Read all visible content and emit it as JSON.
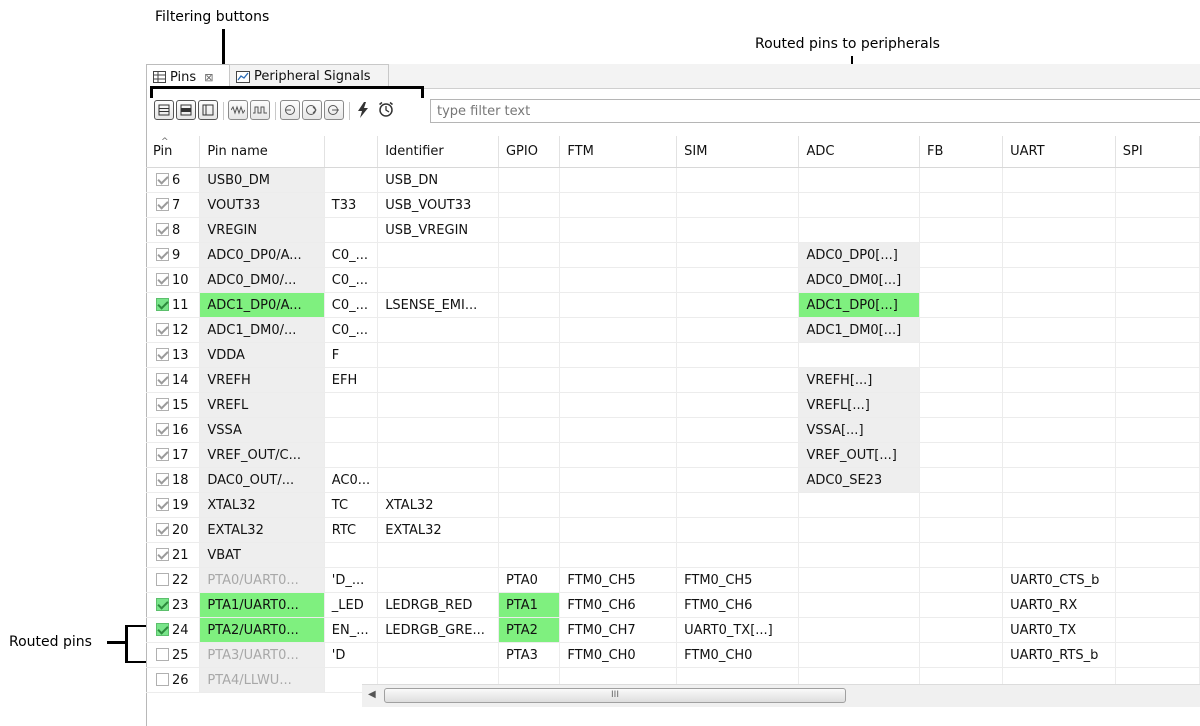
{
  "callouts": {
    "filtering_buttons": "Filtering buttons",
    "routed_to_peripherals": "Routed pins to peripherals",
    "routed_pins": "Routed pins"
  },
  "tabs": [
    {
      "label": "Pins",
      "icon": "table-icon",
      "active": true,
      "close": "⊠"
    },
    {
      "label": "Peripheral Signals",
      "icon": "chart-icon",
      "active": false
    }
  ],
  "toolbar": {
    "filter_placeholder": "type filter text",
    "buttons": [
      "show-all-pins-icon",
      "show-routed-pins-icon",
      "show-unrouted-pins-icon",
      "signal-wave-icon",
      "signal-pulse-icon",
      "route-out-icon",
      "route-in-icon",
      "route-both-icon",
      "power-icon",
      "alarm-clock-icon"
    ]
  },
  "table": {
    "columns": [
      "Pin",
      "Pin name",
      "",
      "Identifier",
      "GPIO",
      "FTM",
      "SIM",
      "ADC",
      "FB",
      "UART",
      "SPI"
    ],
    "rows": [
      {
        "pin": "6",
        "name": "USB0_DM",
        "label": "",
        "id": "USB_DN",
        "gpio": "",
        "ftm": "",
        "sim": "",
        "adc": "",
        "fb": "",
        "uart": "",
        "spi": ""
      },
      {
        "pin": "7",
        "name": "VOUT33",
        "label": "T33",
        "id": "USB_VOUT33",
        "gpio": "",
        "ftm": "",
        "sim": "",
        "adc": "",
        "fb": "",
        "uart": "",
        "spi": ""
      },
      {
        "pin": "8",
        "name": "VREGIN",
        "label": "",
        "id": "USB_VREGIN",
        "gpio": "",
        "ftm": "",
        "sim": "",
        "adc": "",
        "fb": "",
        "uart": "",
        "spi": ""
      },
      {
        "pin": "9",
        "name": "ADC0_DP0/A...",
        "label": "C0_...",
        "id": "",
        "gpio": "",
        "ftm": "",
        "sim": "",
        "adc": "ADC0_DP0[...]",
        "fb": "",
        "uart": "",
        "spi": ""
      },
      {
        "pin": "10",
        "name": "ADC0_DM0/...",
        "label": "C0_...",
        "id": "",
        "gpio": "",
        "ftm": "",
        "sim": "",
        "adc": "ADC0_DM0[...]",
        "fb": "",
        "uart": "",
        "spi": ""
      },
      {
        "pin": "11",
        "name": "ADC1_DP0/A...",
        "label": "C0_...",
        "id": "LSENSE_EMI...",
        "gpio": "",
        "ftm": "",
        "sim": "",
        "adc": "ADC1_DP0[...]",
        "fb": "",
        "uart": "",
        "spi": ""
      },
      {
        "pin": "12",
        "name": "ADC1_DM0/...",
        "label": "C0_...",
        "id": "",
        "gpio": "",
        "ftm": "",
        "sim": "",
        "adc": "ADC1_DM0[...]",
        "fb": "",
        "uart": "",
        "spi": ""
      },
      {
        "pin": "13",
        "name": "VDDA",
        "label": "F",
        "id": "",
        "gpio": "",
        "ftm": "",
        "sim": "",
        "adc": "",
        "fb": "",
        "uart": "",
        "spi": ""
      },
      {
        "pin": "14",
        "name": "VREFH",
        "label": "EFH",
        "id": "",
        "gpio": "",
        "ftm": "",
        "sim": "",
        "adc": "VREFH[...]",
        "fb": "",
        "uart": "",
        "spi": ""
      },
      {
        "pin": "15",
        "name": "VREFL",
        "label": "",
        "id": "",
        "gpio": "",
        "ftm": "",
        "sim": "",
        "adc": "VREFL[...]",
        "fb": "",
        "uart": "",
        "spi": ""
      },
      {
        "pin": "16",
        "name": "VSSA",
        "label": "",
        "id": "",
        "gpio": "",
        "ftm": "",
        "sim": "",
        "adc": "VSSA[...]",
        "fb": "",
        "uart": "",
        "spi": ""
      },
      {
        "pin": "17",
        "name": "VREF_OUT/C...",
        "label": "",
        "id": "",
        "gpio": "",
        "ftm": "",
        "sim": "",
        "adc": "VREF_OUT[...]",
        "fb": "",
        "uart": "",
        "spi": ""
      },
      {
        "pin": "18",
        "name": "DAC0_OUT/...",
        "label": "AC0...",
        "id": "",
        "gpio": "",
        "ftm": "",
        "sim": "",
        "adc": "ADC0_SE23",
        "fb": "",
        "uart": "",
        "spi": ""
      },
      {
        "pin": "19",
        "name": "XTAL32",
        "label": "TC",
        "id": "XTAL32",
        "gpio": "",
        "ftm": "",
        "sim": "",
        "adc": "",
        "fb": "",
        "uart": "",
        "spi": ""
      },
      {
        "pin": "20",
        "name": "EXTAL32",
        "label": "RTC",
        "id": "EXTAL32",
        "gpio": "",
        "ftm": "",
        "sim": "",
        "adc": "",
        "fb": "",
        "uart": "",
        "spi": ""
      },
      {
        "pin": "21",
        "name": "VBAT",
        "label": "",
        "id": "",
        "gpio": "",
        "ftm": "",
        "sim": "",
        "adc": "",
        "fb": "",
        "uart": "",
        "spi": ""
      },
      {
        "pin": "22",
        "name": "PTA0/UART0...",
        "label": "'D_...",
        "id": "",
        "gpio": "PTA0",
        "ftm": "FTM0_CH5",
        "sim": "FTM0_CH5",
        "adc": "",
        "fb": "",
        "uart": "UART0_CTS_b",
        "spi": ""
      },
      {
        "pin": "23",
        "name": "PTA1/UART0...",
        "label": "_LED",
        "id": "LEDRGB_RED",
        "gpio": "PTA1",
        "ftm": "FTM0_CH6",
        "sim": "FTM0_CH6",
        "adc": "",
        "fb": "",
        "uart": "UART0_RX",
        "spi": ""
      },
      {
        "pin": "24",
        "name": "PTA2/UART0...",
        "label": "EN_...",
        "id": "LEDRGB_GRE...",
        "gpio": "PTA2",
        "ftm": "FTM0_CH7",
        "sim": "UART0_TX[...]",
        "adc": "",
        "fb": "",
        "uart": "UART0_TX",
        "spi": ""
      },
      {
        "pin": "25",
        "name": "PTA3/UART0...",
        "label": "'D",
        "id": "",
        "gpio": "PTA3",
        "ftm": "FTM0_CH0",
        "sim": "FTM0_CH0",
        "adc": "",
        "fb": "",
        "uart": "UART0_RTS_b",
        "spi": ""
      },
      {
        "pin": "26",
        "name": "PTA4/LLWU...",
        "label": "",
        "id": "",
        "gpio": "",
        "ftm": "",
        "sim": "",
        "adc": "",
        "fb": "",
        "uart": "",
        "spi": ""
      }
    ]
  },
  "scrollbar": {
    "grip": "III",
    "left_arrow": "◀"
  },
  "colors": {
    "routed_highlight": "#7ff07f",
    "peripheral_cell": "#eeeeee"
  }
}
